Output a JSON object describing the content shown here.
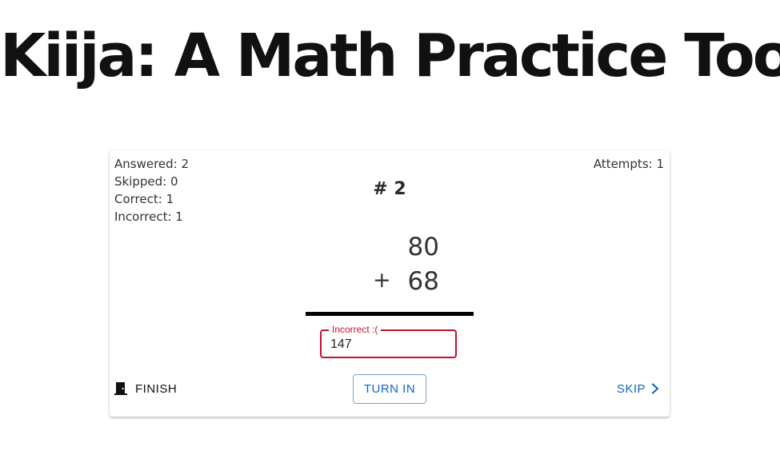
{
  "header": {
    "title": "Kiija: A Math Practice Tool"
  },
  "stats": {
    "answered": "Answered: 2",
    "skipped": "Skipped: 0",
    "correct": "Correct: 1",
    "incorrect": "Incorrect: 1",
    "attempts": "Attempts: 1"
  },
  "problem": {
    "number": "# 2",
    "operand_top": "80",
    "operator": "+",
    "operand_bottom": "68"
  },
  "answer": {
    "label": "Incorrect :(",
    "value": "147",
    "status_color": "#c8102e"
  },
  "actions": {
    "finish_label": "FINISH",
    "finish_icon": "door-icon",
    "turn_in_label": "TURN IN",
    "skip_label": "SKIP",
    "skip_icon": "chevron-right-icon",
    "accent_color": "#1565c0"
  }
}
